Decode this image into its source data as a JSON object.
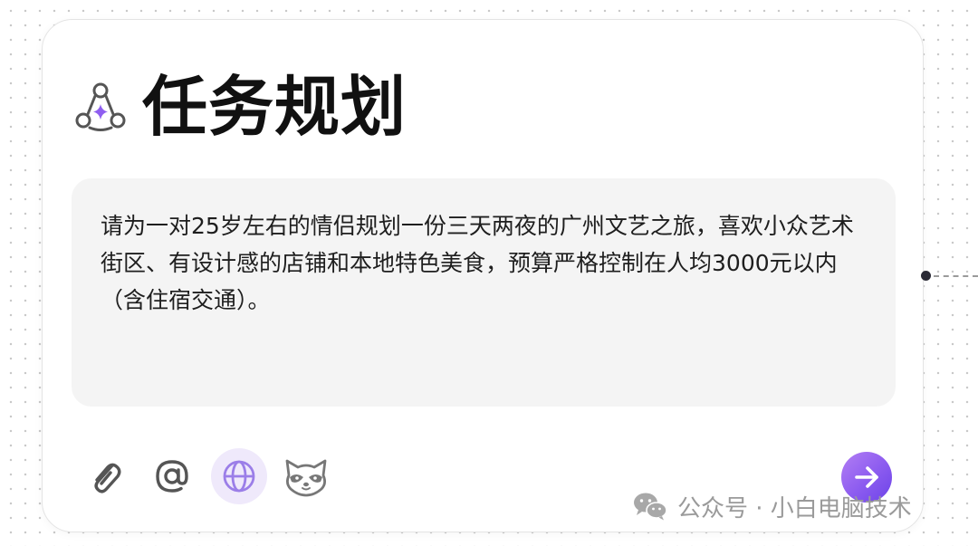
{
  "card": {
    "title": "任务规划",
    "prompt": "请为一对25岁左右的情侣规划一份三天两夜的广州文艺之旅，喜欢小众艺术街区、有设计感的店铺和本地特色美食，预算严格控制在人均3000元以内（含住宿交通）。"
  },
  "toolbar": {
    "items": [
      {
        "icon": "paperclip-icon",
        "active": false
      },
      {
        "icon": "at-sign-icon",
        "active": false
      },
      {
        "icon": "globe-icon",
        "active": true
      },
      {
        "icon": "raccoon-icon",
        "active": false
      }
    ],
    "send_icon": "arrow-right-icon"
  },
  "watermark": {
    "text": "公众号 · 小白电脑技术",
    "icon": "wechat-icon"
  },
  "colors": {
    "accent": "#8f5ef0",
    "active_bg": "#efe9fb",
    "prompt_bg": "#f4f4f4",
    "title": "#111111",
    "icon_gray": "#555555"
  }
}
